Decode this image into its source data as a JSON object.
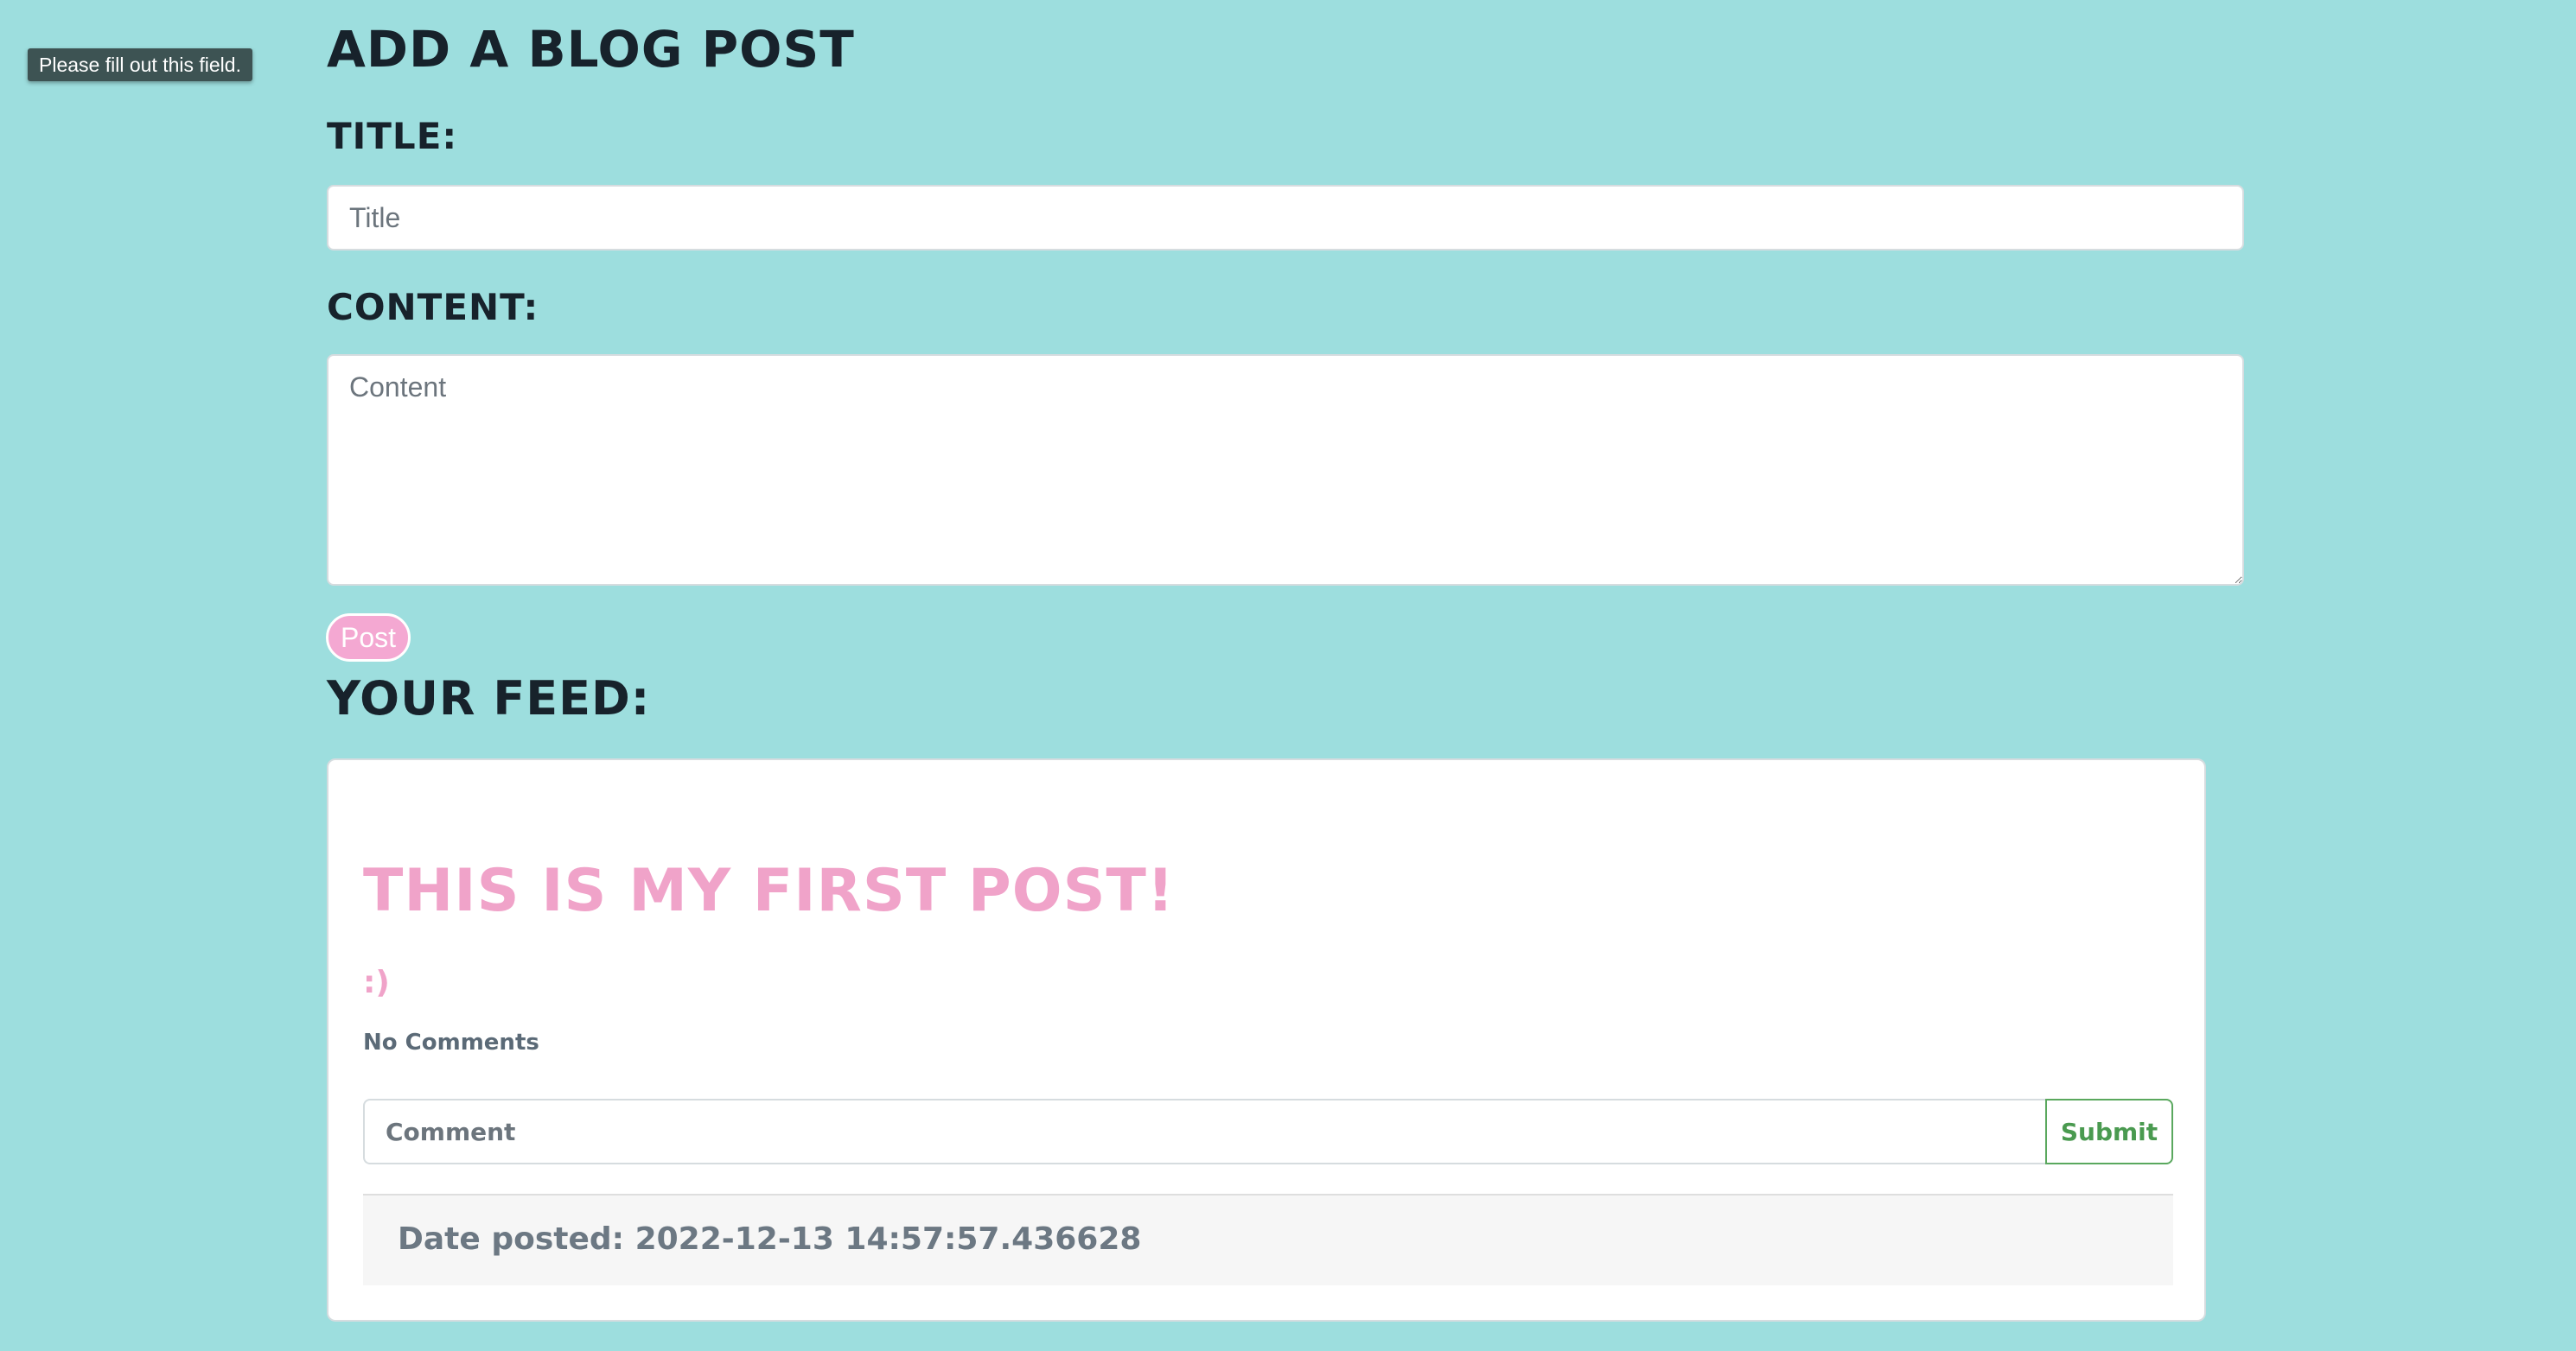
{
  "validation_tooltip": {
    "text": "Please fill out this field."
  },
  "form": {
    "heading": "ADD A BLOG POST",
    "title_label": "TITLE:",
    "title_placeholder": "Title",
    "title_value": "",
    "content_label": "CONTENT:",
    "content_placeholder": "Content",
    "content_value": "",
    "post_button_label": "Post"
  },
  "feed": {
    "heading": "YOUR FEED:",
    "posts": [
      {
        "title": "THIS IS MY FIRST POST!",
        "content": ":)",
        "comments_status": "No Comments",
        "comment_placeholder": "Comment",
        "comment_value": "",
        "submit_label": "Submit",
        "date_posted": "Date posted: 2022-12-13 14:57:57.436628"
      }
    ]
  },
  "colors": {
    "page_background": "#9ddede",
    "accent_pink": "#f0a3c9",
    "post_button_background": "#f4a8d2",
    "submit_green": "#4a9a50",
    "heading_text": "#17222b"
  }
}
